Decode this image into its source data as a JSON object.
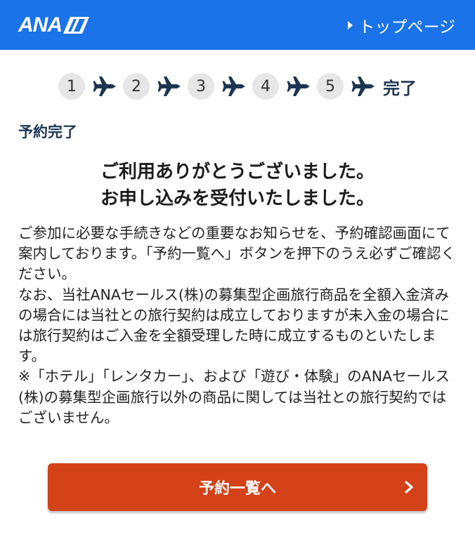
{
  "header": {
    "logo_text": "ANA",
    "top_page_link": "トップページ",
    "background": "#1a73e8"
  },
  "steps": {
    "items": [
      "1",
      "2",
      "3",
      "4",
      "5"
    ],
    "done_label": "完了"
  },
  "page_title": "予約完了",
  "thanks": {
    "line1": "ご利用ありがとうございました。",
    "line2": "お申し込みを受付いたしました。"
  },
  "notice": {
    "paragraph1": "ご参加に必要な手続きなどの重要なお知らせを、予約確認画面にて案内しております。「予約一覧へ」ボタンを押下のうえ必ずご確認ください。",
    "paragraph2": "なお、当社ANAセールス(株)の募集型企画旅行商品を全額入金済みの場合には当社との旅行契約は成立しておりますが未入金の場合には旅行契約はご入金を全額受理した時に成立するものといたします。",
    "paragraph3": "※「ホテル」「レンタカー」、および「遊び・体験」のANAセールス(株)の募集型企画旅行以外の商品に関しては当社との旅行契約ではございません。"
  },
  "primary_button": {
    "label": "予約一覧へ",
    "color": "#d4421a"
  },
  "icons": {
    "step_separator": "airplane-icon",
    "button_arrow": "chevron-right-icon",
    "link_marker": "triangle-right-icon"
  }
}
